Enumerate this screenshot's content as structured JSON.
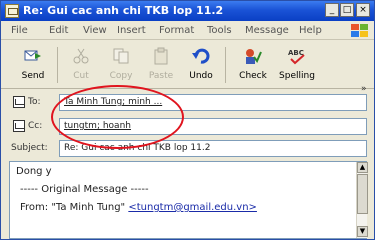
{
  "window": {
    "title": "Re: Gui cac anh chi TKB lop 11.2",
    "icon": "message-icon",
    "controls": {
      "minimize": "_",
      "maximize": "□",
      "close": "×"
    }
  },
  "menu": [
    "File",
    "Edit",
    "View",
    "Insert",
    "Format",
    "Tools",
    "Message",
    "Help"
  ],
  "toolbar": {
    "send": "Send",
    "cut": "Cut",
    "copy": "Copy",
    "paste": "Paste",
    "undo": "Undo",
    "check": "Check",
    "spelling": "Spelling",
    "more": "»"
  },
  "colors": {
    "title_bar": "#1a53d6",
    "highlight_ring": "#e0141e",
    "link": "#1a2ba8"
  },
  "fields": {
    "to_label": "To:",
    "to_value": "Ta Minh Tung; minh ...",
    "cc_label": "Cc:",
    "cc_value": "tungtm; hoanh",
    "subject_label": "Subject:",
    "subject_value": "Re: Gui cac anh chi TKB lop 11.2"
  },
  "body": {
    "greeting": "Dong y",
    "separator": "----- Original Message -----",
    "from_prefix": "From: \"Ta Minh Tung\"",
    "from_email": "<tungtm@gmail.edu.vn>"
  }
}
